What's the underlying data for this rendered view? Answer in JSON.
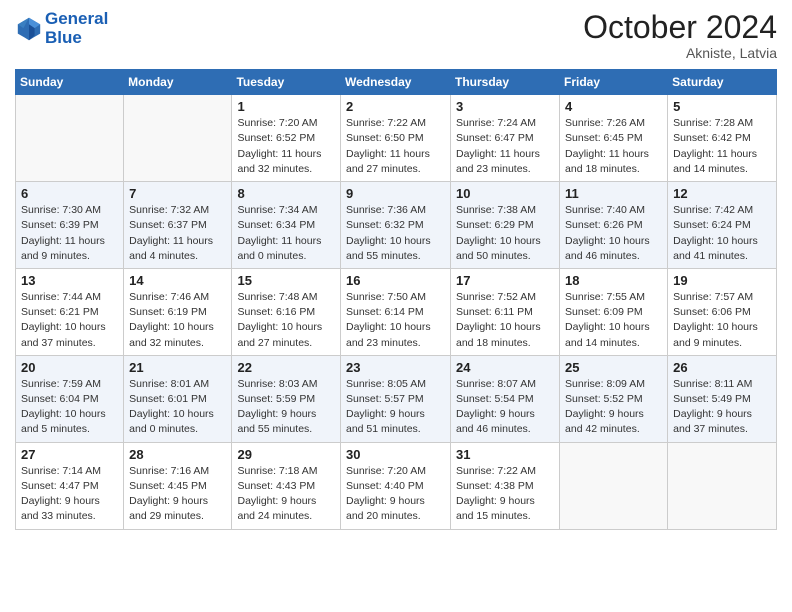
{
  "header": {
    "logo_line1": "General",
    "logo_line2": "Blue",
    "month": "October 2024",
    "location": "Akniste, Latvia"
  },
  "days_of_week": [
    "Sunday",
    "Monday",
    "Tuesday",
    "Wednesday",
    "Thursday",
    "Friday",
    "Saturday"
  ],
  "weeks": [
    [
      {
        "day": "",
        "info": ""
      },
      {
        "day": "",
        "info": ""
      },
      {
        "day": "1",
        "info": "Sunrise: 7:20 AM\nSunset: 6:52 PM\nDaylight: 11 hours and 32 minutes."
      },
      {
        "day": "2",
        "info": "Sunrise: 7:22 AM\nSunset: 6:50 PM\nDaylight: 11 hours and 27 minutes."
      },
      {
        "day": "3",
        "info": "Sunrise: 7:24 AM\nSunset: 6:47 PM\nDaylight: 11 hours and 23 minutes."
      },
      {
        "day": "4",
        "info": "Sunrise: 7:26 AM\nSunset: 6:45 PM\nDaylight: 11 hours and 18 minutes."
      },
      {
        "day": "5",
        "info": "Sunrise: 7:28 AM\nSunset: 6:42 PM\nDaylight: 11 hours and 14 minutes."
      }
    ],
    [
      {
        "day": "6",
        "info": "Sunrise: 7:30 AM\nSunset: 6:39 PM\nDaylight: 11 hours and 9 minutes."
      },
      {
        "day": "7",
        "info": "Sunrise: 7:32 AM\nSunset: 6:37 PM\nDaylight: 11 hours and 4 minutes."
      },
      {
        "day": "8",
        "info": "Sunrise: 7:34 AM\nSunset: 6:34 PM\nDaylight: 11 hours and 0 minutes."
      },
      {
        "day": "9",
        "info": "Sunrise: 7:36 AM\nSunset: 6:32 PM\nDaylight: 10 hours and 55 minutes."
      },
      {
        "day": "10",
        "info": "Sunrise: 7:38 AM\nSunset: 6:29 PM\nDaylight: 10 hours and 50 minutes."
      },
      {
        "day": "11",
        "info": "Sunrise: 7:40 AM\nSunset: 6:26 PM\nDaylight: 10 hours and 46 minutes."
      },
      {
        "day": "12",
        "info": "Sunrise: 7:42 AM\nSunset: 6:24 PM\nDaylight: 10 hours and 41 minutes."
      }
    ],
    [
      {
        "day": "13",
        "info": "Sunrise: 7:44 AM\nSunset: 6:21 PM\nDaylight: 10 hours and 37 minutes."
      },
      {
        "day": "14",
        "info": "Sunrise: 7:46 AM\nSunset: 6:19 PM\nDaylight: 10 hours and 32 minutes."
      },
      {
        "day": "15",
        "info": "Sunrise: 7:48 AM\nSunset: 6:16 PM\nDaylight: 10 hours and 27 minutes."
      },
      {
        "day": "16",
        "info": "Sunrise: 7:50 AM\nSunset: 6:14 PM\nDaylight: 10 hours and 23 minutes."
      },
      {
        "day": "17",
        "info": "Sunrise: 7:52 AM\nSunset: 6:11 PM\nDaylight: 10 hours and 18 minutes."
      },
      {
        "day": "18",
        "info": "Sunrise: 7:55 AM\nSunset: 6:09 PM\nDaylight: 10 hours and 14 minutes."
      },
      {
        "day": "19",
        "info": "Sunrise: 7:57 AM\nSunset: 6:06 PM\nDaylight: 10 hours and 9 minutes."
      }
    ],
    [
      {
        "day": "20",
        "info": "Sunrise: 7:59 AM\nSunset: 6:04 PM\nDaylight: 10 hours and 5 minutes."
      },
      {
        "day": "21",
        "info": "Sunrise: 8:01 AM\nSunset: 6:01 PM\nDaylight: 10 hours and 0 minutes."
      },
      {
        "day": "22",
        "info": "Sunrise: 8:03 AM\nSunset: 5:59 PM\nDaylight: 9 hours and 55 minutes."
      },
      {
        "day": "23",
        "info": "Sunrise: 8:05 AM\nSunset: 5:57 PM\nDaylight: 9 hours and 51 minutes."
      },
      {
        "day": "24",
        "info": "Sunrise: 8:07 AM\nSunset: 5:54 PM\nDaylight: 9 hours and 46 minutes."
      },
      {
        "day": "25",
        "info": "Sunrise: 8:09 AM\nSunset: 5:52 PM\nDaylight: 9 hours and 42 minutes."
      },
      {
        "day": "26",
        "info": "Sunrise: 8:11 AM\nSunset: 5:49 PM\nDaylight: 9 hours and 37 minutes."
      }
    ],
    [
      {
        "day": "27",
        "info": "Sunrise: 7:14 AM\nSunset: 4:47 PM\nDaylight: 9 hours and 33 minutes."
      },
      {
        "day": "28",
        "info": "Sunrise: 7:16 AM\nSunset: 4:45 PM\nDaylight: 9 hours and 29 minutes."
      },
      {
        "day": "29",
        "info": "Sunrise: 7:18 AM\nSunset: 4:43 PM\nDaylight: 9 hours and 24 minutes."
      },
      {
        "day": "30",
        "info": "Sunrise: 7:20 AM\nSunset: 4:40 PM\nDaylight: 9 hours and 20 minutes."
      },
      {
        "day": "31",
        "info": "Sunrise: 7:22 AM\nSunset: 4:38 PM\nDaylight: 9 hours and 15 minutes."
      },
      {
        "day": "",
        "info": ""
      },
      {
        "day": "",
        "info": ""
      }
    ]
  ]
}
